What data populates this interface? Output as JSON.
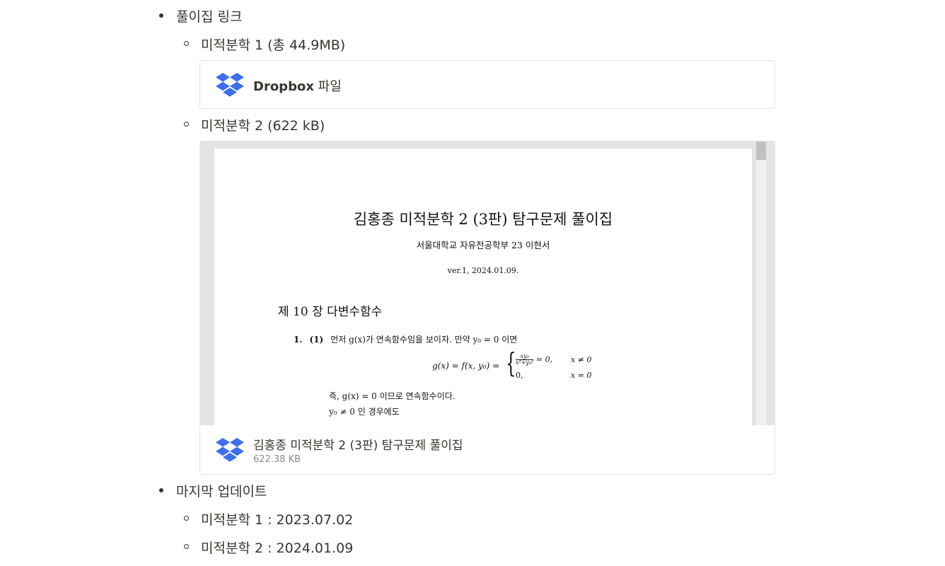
{
  "section1": {
    "title": "풀이집 링크",
    "items": [
      {
        "label": "미적분학 1 (총 44.9MB)"
      },
      {
        "label": "미적분학 2 (622 kB)"
      }
    ]
  },
  "dropbox_card": {
    "brand": "Dropbox",
    "suffix": " 파일",
    "icon": "dropbox-icon",
    "icon_color": "#3d6fe8"
  },
  "embed": {
    "document": {
      "title": "김홍종 미적분학 2 (3판) 탐구문제 풀이집",
      "author": "서울대학교 자유전공학부 23 이현서",
      "version": "ver.1, 2024.01.09.",
      "chapter": "제 10 장 다변수함수",
      "problem_number": "1.",
      "problem_part": "(1)",
      "problem_text": "먼저 g(x)가 연속함수임을 보이자. 만약 y₀ = 0 이면",
      "equation_lhs": "g(x) = f(x, y₀) =",
      "case1_num": "xy₀",
      "case1_den": "x²+y₀²",
      "case1_rest": " = 0,",
      "case1_cond": "x ≠ 0",
      "case2_value": "0,",
      "case2_cond": "x = 0",
      "line1": "즉, g(x) = 0 이므로 연속함수이다.",
      "line2": "y₀ ≠ 0 인 경우에도"
    },
    "file_name": "김홍종 미적분학 2 (3판) 탐구문제 풀이집",
    "file_size": "622.38 KB"
  },
  "section2": {
    "title": "마지막 업데이트",
    "items": [
      {
        "label": "미적분학 1 : 2023.07.02"
      },
      {
        "label": "미적분학 2 : 2024.01.09"
      }
    ]
  }
}
